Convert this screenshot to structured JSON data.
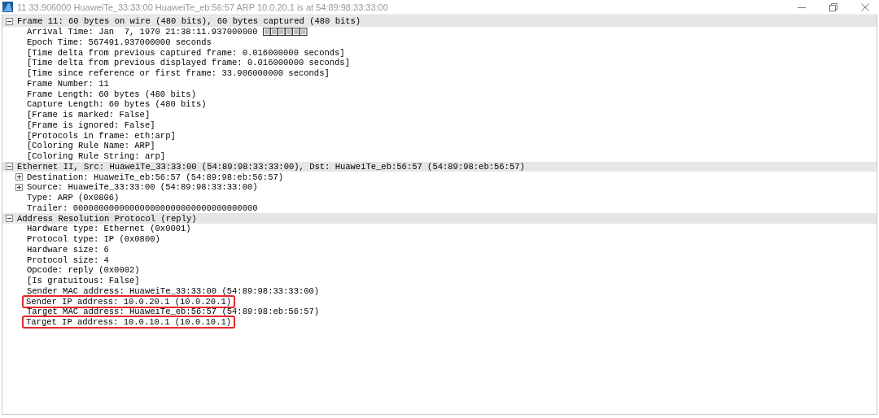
{
  "window": {
    "title": "11 33.906000 HuaweiTe_33:33:00 HuaweiTe_eb:56:57 ARP 10.0.20.1 is at 54:89:98:33:33:00"
  },
  "tree": [
    {
      "text": "Frame 11: 60 bytes on wire (480 bits), 60 bytes captured (480 bits)",
      "expanded": true,
      "children": [
        {
          "text": "Arrival Time: Jan  7, 1970 21:38:11.937000000",
          "missing_glyphs": true
        },
        {
          "text": "Epoch Time: 567491.937000000 seconds"
        },
        {
          "text": "[Time delta from previous captured frame: 0.016000000 seconds]"
        },
        {
          "text": "[Time delta from previous displayed frame: 0.016000000 seconds]"
        },
        {
          "text": "[Time since reference or first frame: 33.906000000 seconds]"
        },
        {
          "text": "Frame Number: 11"
        },
        {
          "text": "Frame Length: 60 bytes (480 bits)"
        },
        {
          "text": "Capture Length: 60 bytes (480 bits)"
        },
        {
          "text": "[Frame is marked: False]"
        },
        {
          "text": "[Frame is ignored: False]"
        },
        {
          "text": "[Protocols in frame: eth:arp]"
        },
        {
          "text": "[Coloring Rule Name: ARP]"
        },
        {
          "text": "[Coloring Rule String: arp]"
        }
      ]
    },
    {
      "text": "Ethernet II, Src: HuaweiTe_33:33:00 (54:89:98:33:33:00), Dst: HuaweiTe_eb:56:57 (54:89:98:eb:56:57)",
      "expanded": true,
      "children": [
        {
          "text": "Destination: HuaweiTe_eb:56:57 (54:89:98:eb:56:57)",
          "expanded": false
        },
        {
          "text": "Source: HuaweiTe_33:33:00 (54:89:98:33:33:00)",
          "expanded": false
        },
        {
          "text": "Type: ARP (0x0806)"
        },
        {
          "text": "Trailer: 000000000000000000000000000000000000"
        }
      ]
    },
    {
      "text": "Address Resolution Protocol (reply)",
      "expanded": true,
      "children": [
        {
          "text": "Hardware type: Ethernet (0x0001)",
          "highlighted": false
        },
        {
          "text": "Protocol type: IP (0x0800)",
          "highlighted": false
        },
        {
          "text": "Hardware size: 6",
          "highlighted": false
        },
        {
          "text": "Protocol size: 4",
          "highlighted": false
        },
        {
          "text": "Opcode: reply (0x0002)",
          "highlighted": false
        },
        {
          "text": "[Is gratuitous: False]",
          "highlighted": false
        },
        {
          "text": "Sender MAC address: HuaweiTe_33:33:00 (54:89:98:33:33:00)",
          "highlighted": false
        },
        {
          "text": "Sender IP address: 10.0.20.1 (10.0.20.1)",
          "highlighted": true
        },
        {
          "text": "Target MAC address: HuaweiTe_eb:56:57 (54:89:98:eb:56:57)",
          "highlighted": false
        },
        {
          "text": "Target IP address: 10.0.10.1 (10.0.10.1)",
          "highlighted": true
        }
      ]
    }
  ]
}
